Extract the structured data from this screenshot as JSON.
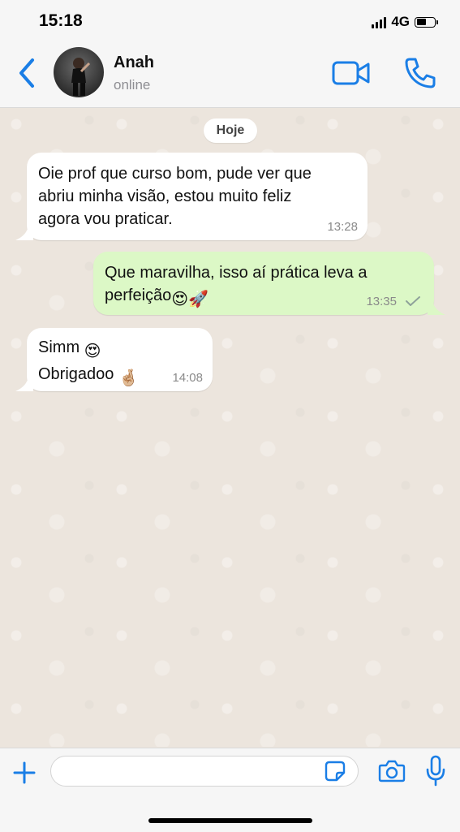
{
  "status_bar": {
    "time": "15:18",
    "network": "4G"
  },
  "header": {
    "contact_name": "Anah",
    "contact_status": "online"
  },
  "chat": {
    "date_label": "Hoje",
    "messages": [
      {
        "direction": "incoming",
        "text": "Oie prof que curso bom, pude ver que\nabriu minha visão, estou muito feliz\nagora vou praticar.",
        "time": "13:28"
      },
      {
        "direction": "outgoing",
        "text": "Que maravilha, isso aí prática leva a\nperfeição",
        "emojis": [
          "😍",
          "🚀"
        ],
        "time": "13:35",
        "status": "sent"
      },
      {
        "direction": "incoming",
        "line1": "Simm",
        "line1_emoji": "😍",
        "line2": "Obrigadoo",
        "line2_emoji": "🤞🏼",
        "time": "14:08"
      }
    ]
  },
  "composer": {
    "input_value": "",
    "input_placeholder": ""
  },
  "icons": [
    "back-icon",
    "video-call-icon",
    "phone-icon",
    "plus-icon",
    "sticker-icon",
    "camera-icon",
    "microphone-icon",
    "read-check-icon"
  ],
  "colors": {
    "accent": "#1a7ee6",
    "outgoing_bubble": "#dcf8c6",
    "incoming_bubble": "#ffffff",
    "chat_background": "#ece5dd"
  }
}
